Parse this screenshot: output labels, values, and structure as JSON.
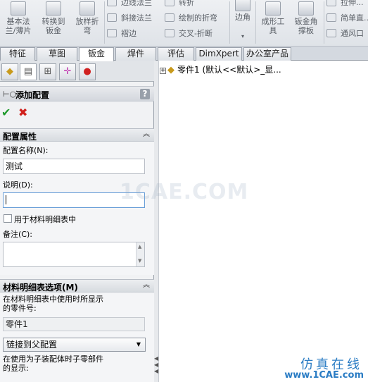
{
  "ribbon": {
    "btn1": "基本法\n兰/薄片",
    "btn2": "转换到\n钣金",
    "btn3": "放样折\n弯",
    "small1": "边线法兰",
    "small2": "斜接法兰",
    "small3": "褶边",
    "small4": "转折",
    "small5": "绘制的折弯",
    "small6": "交叉-折断",
    "corner": "边角",
    "form": "成形工\n具",
    "gusset": "钣金角\n撑板",
    "small7": "拉伸...",
    "small8": "简单直...",
    "small9": "通风口"
  },
  "tabs": [
    "特征",
    "草图",
    "钣金",
    "焊件",
    "评估",
    "DimXpert",
    "办公室产品"
  ],
  "panel": {
    "title": "添加配置",
    "help": "?",
    "ok": "✔",
    "cancel": "✖",
    "props_title": "配置属性",
    "name_label": "配置名称(N):",
    "name_value": "测试",
    "desc_label": "说明(D):",
    "desc_value": "",
    "bom_check_label": "用于材料明细表中",
    "comment_label": "备注(C):",
    "bom_title": "材料明细表选项(M)",
    "bom_desc": "在材料明细表中使用时所显示的零件号:",
    "part_no": "零件1",
    "link_option": "链接到父配置",
    "child_desc": "在使用为子装配体时子零部件的显示:"
  },
  "tree": {
    "item": "零件1  (默认<<默认>_显..."
  },
  "watermark": "1CAE.COM",
  "brand": {
    "cn": "仿真在线",
    "url": "www.1CAE.com"
  }
}
